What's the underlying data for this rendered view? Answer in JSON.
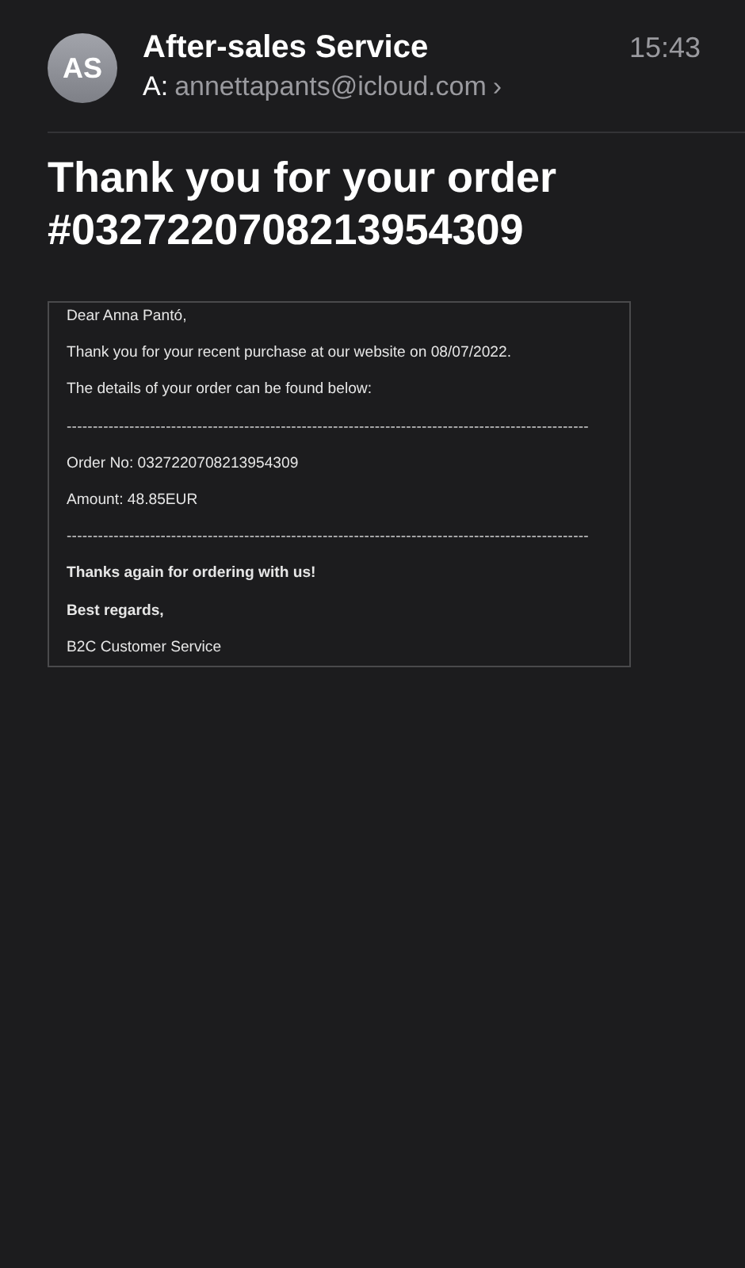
{
  "header": {
    "avatar_initials": "AS",
    "sender": "After-sales Service",
    "recipient_label": "A:",
    "recipient": "annettapants@icloud.com",
    "chevron": "›",
    "time": "15:43"
  },
  "subject": "Thank you for your order #0327220708213954309",
  "body": [
    {
      "kind": "text",
      "text": "Dear Anna Pantó,"
    },
    {
      "kind": "text",
      "text": "Thank you for your recent purchase at our website on 08/07/2022."
    },
    {
      "kind": "text",
      "text": "The details of your order can be found below:"
    },
    {
      "kind": "rule",
      "text": "----------------------------------------------------------------------------------------------------"
    },
    {
      "kind": "text",
      "text": "Order No: 0327220708213954309"
    },
    {
      "kind": "text",
      "text": "Amount: 48.85EUR"
    },
    {
      "kind": "rule",
      "text": "----------------------------------------------------------------------------------------------------"
    },
    {
      "kind": "bold",
      "text": "Thanks again for ordering with us!"
    },
    {
      "kind": "bold",
      "text": "Best regards,"
    },
    {
      "kind": "text",
      "text": "B2C Customer Service"
    }
  ]
}
